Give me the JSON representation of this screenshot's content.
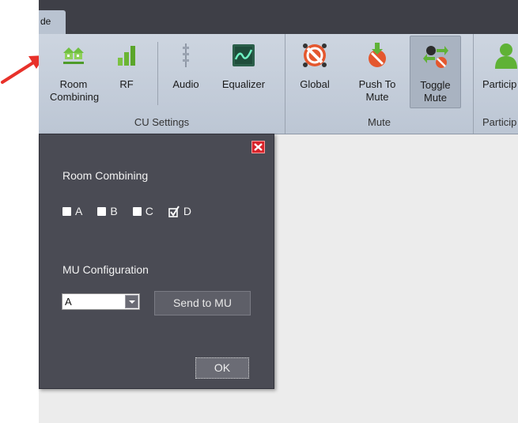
{
  "tab": {
    "label": "de"
  },
  "ribbon": {
    "buttons": [
      {
        "id": "room-combining",
        "label": "Room\nCombining",
        "icon": "house-network-icon"
      },
      {
        "id": "rf",
        "label": "RF",
        "icon": "signal-bars-icon"
      },
      {
        "id": "audio",
        "label": "Audio",
        "icon": "mixer-sliders-icon"
      },
      {
        "id": "equalizer",
        "label": "Equalizer",
        "icon": "equalizer-wave-icon"
      },
      {
        "id": "global",
        "label": "Global",
        "icon": "global-mute-icon"
      },
      {
        "id": "push-to-mute",
        "label": "Push To\nMute",
        "icon": "push-to-mute-icon"
      },
      {
        "id": "toggle-mute",
        "label": "Toggle\nMute",
        "icon": "toggle-mute-icon"
      },
      {
        "id": "participants",
        "label": "Particip",
        "icon": "participant-icon"
      }
    ],
    "groups": [
      {
        "label": "CU Settings"
      },
      {
        "label": "Mute"
      },
      {
        "label": "Particip"
      }
    ]
  },
  "dialog": {
    "room_combining_label": "Room Combining",
    "rooms": [
      {
        "label": "A",
        "checked": false
      },
      {
        "label": "B",
        "checked": false
      },
      {
        "label": "C",
        "checked": false
      },
      {
        "label": "D",
        "checked": true
      }
    ],
    "mu_config_label": "MU Configuration",
    "mu_select_value": "A",
    "send_button": "Send to MU",
    "ok_button": "OK"
  },
  "colors": {
    "titlebar": "#3e3f47",
    "ribbon": "#c6cfdb",
    "dialog_bg": "#4a4b54",
    "close_red": "#d9242b",
    "annotation_arrow": "#e8312a"
  }
}
